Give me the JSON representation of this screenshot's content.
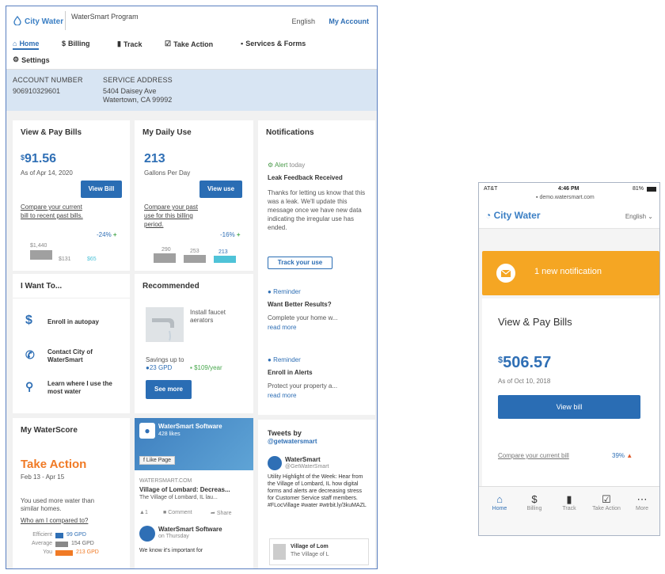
{
  "desktop": {
    "brand": "City Water",
    "program": "WaterSmart Program",
    "lang": "English",
    "my_account": "My Account",
    "nav": {
      "home": "Home",
      "billing": "Billing",
      "track": "Track",
      "take_action": "Take Action",
      "services": "Services & Forms",
      "settings": "Settings"
    },
    "account": {
      "num_label": "ACCOUNT NUMBER",
      "num": "906910329601",
      "addr_label": "SERVICE ADDRESS",
      "addr1": "5404 Daisey Ave",
      "addr2": "Watertown, CA 99992"
    },
    "bills": {
      "title": "View & Pay Bills",
      "cur": "$",
      "amount": "91.56",
      "asof": "As of Apr 14, 2020",
      "btn": "View Bill",
      "link": "Compare your current bill to recent past bills.",
      "pct": "-24%",
      "lbl1": "$1,440",
      "lbl2": "$131",
      "lbl3": "$65"
    },
    "daily": {
      "title": "My Daily Use",
      "amount": "213",
      "unit": "Gallons Per Day",
      "btn": "View use",
      "link": "Compare your past use for this billing period.",
      "pct": "-16%",
      "lbl1": "290",
      "lbl2": "253",
      "lbl3": "213"
    },
    "notif": {
      "title": "Notifications",
      "alert_label": "Alert",
      "alert_when": "today",
      "alert_title": "Leak Feedback Received",
      "alert_body": "Thanks for letting us know that this was a leak. We'll update this message once we have new data indicating the irregular use has ended.",
      "track_btn": "Track your use",
      "rem1_label": "Reminder",
      "rem1_title": "Want Better Results?",
      "rem1_body": "Complete your home w...",
      "read_more": "read more",
      "rem2_label": "Reminder",
      "rem2_title": "Enroll in Alerts",
      "rem2_body": "Protect your property a..."
    },
    "iwant": {
      "title": "I Want To...",
      "item1": "Enroll in autopay",
      "item2": "Contact City of WaterSmart",
      "item3": "Learn where I use the most water"
    },
    "rec": {
      "title": "Recommended",
      "text": "Install faucet aerators",
      "savings": "Savings up to",
      "gpd": "23 GPD",
      "dollars": "$109/year",
      "btn": "See more"
    },
    "score": {
      "title": "My WaterScore",
      "action": "Take Action",
      "range": "Feb 13 - Apr 15",
      "text": "You used more water than similar homes.",
      "link": "Who am I compared to?",
      "eff_label": "Efficient",
      "eff": "99 GPD",
      "avg_label": "Average",
      "avg": "154 GPD",
      "you_label": "You",
      "you": "213 GPD"
    },
    "fb": {
      "page": "WaterSmart Software",
      "likes": "428 likes",
      "like_btn": "Like Page",
      "domain": "WATERSMART.COM",
      "title": "Village of Lombard: Decreas...",
      "desc": "The Village of Lombard, IL lau...",
      "likes_n": "1",
      "comment": "Comment",
      "share": "Share",
      "post_author": "WaterSmart Software",
      "post_when": "on Thursday",
      "post_text": "We know it's important for"
    },
    "tweets": {
      "title": "Tweets by",
      "handle": "@getwatersmart",
      "name": "WaterSmart",
      "user": "@GetWaterSmart",
      "text": "Utility Highlight of the Week: Hear from the Village of Lombard, IL how digital forms and alerts are decreasing stress for Customer Service staff members. #FLocVillage #water #wtrbit.ly/3kuMAZL",
      "card_title": "Village of Lom",
      "card_sub": "The Village of L"
    }
  },
  "mobile": {
    "carrier": "AT&T",
    "time": "4:46 PM",
    "battery": "81%",
    "url": "demo.watersmart.com",
    "brand": "City Water",
    "lang": "English",
    "notification": "1 new notification",
    "title": "View & Pay Bills",
    "cur": "$",
    "amount": "506.57",
    "asof": "As of Oct 10, 2018",
    "btn": "View bill",
    "link": "Compare your current bill",
    "pct": "39%",
    "tabs": {
      "home": "Home",
      "billing": "Billing",
      "track": "Track",
      "take_action": "Take Action",
      "more": "More"
    }
  },
  "colors": {
    "brand_blue": "#2f6fb5",
    "button_blue": "#2a6db4",
    "orange": "#f5a623",
    "take_action": "#f07a25",
    "cyan": "#4fc3d8"
  }
}
